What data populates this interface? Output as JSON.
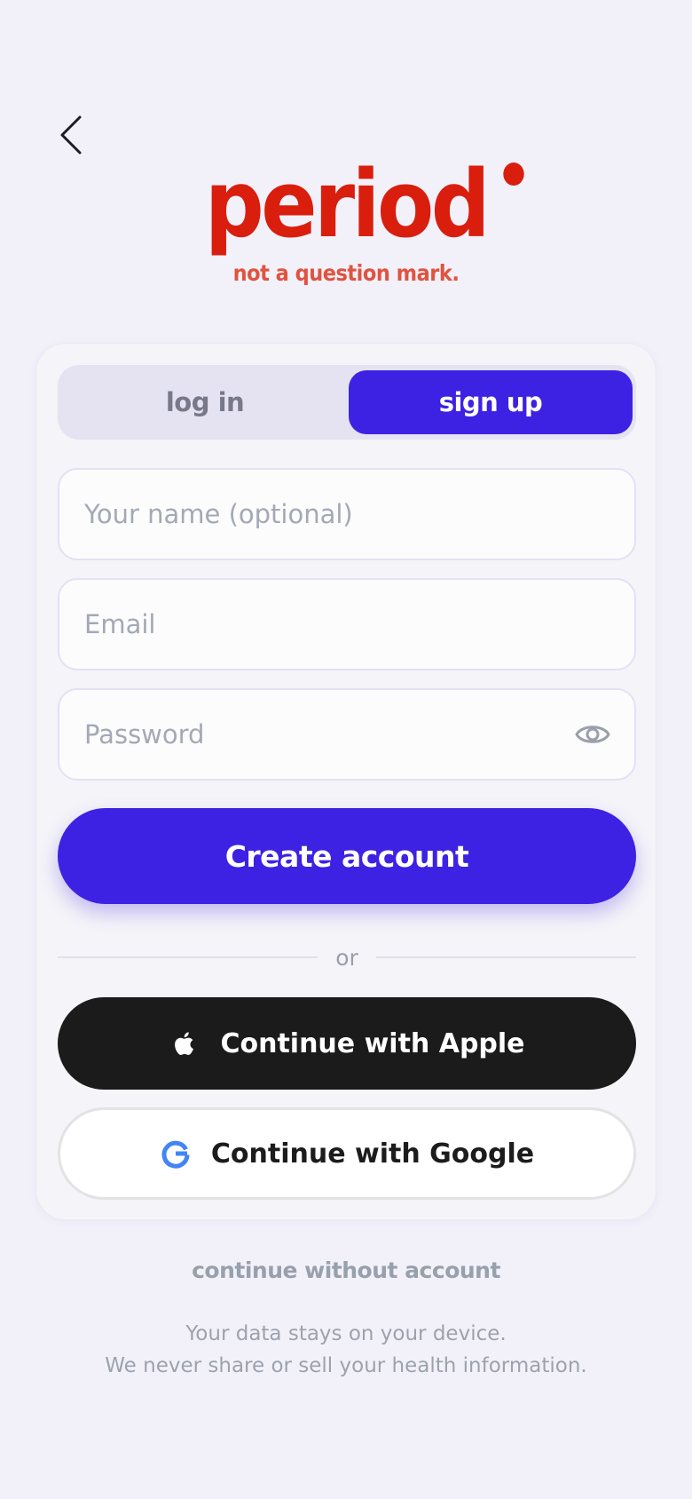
{
  "brand": {
    "name": "period",
    "tagline": "not a question mark."
  },
  "auth": {
    "tabs": [
      {
        "label": "log in",
        "active": false
      },
      {
        "label": "sign up",
        "active": true
      }
    ],
    "fields": {
      "name_placeholder": "Your name (optional)",
      "email_placeholder": "Email",
      "password_placeholder": "Password"
    },
    "primary_button": "Create account",
    "divider": "or",
    "apple_button": "Continue with Apple",
    "google_button": "Continue with Google"
  },
  "footer": {
    "skip_link": "continue without account",
    "privacy_line1": "Your data stays on your device.",
    "privacy_line2": "We never share or sell your health information."
  },
  "colors": {
    "background": "#f2f1fa",
    "accent": "#3d22e3",
    "brand_red": "#d91e0e",
    "apple_black": "#1b1b1b"
  },
  "icons": [
    "chevron-left-icon",
    "eye-icon",
    "apple-icon",
    "google-icon"
  ]
}
